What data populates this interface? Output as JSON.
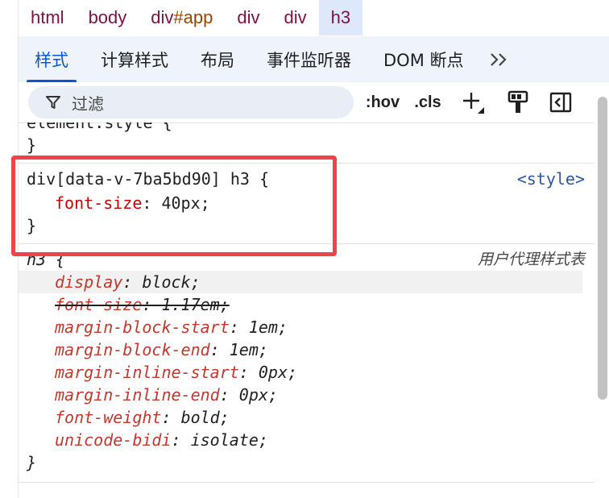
{
  "breadcrumb": {
    "items": [
      {
        "label": "html"
      },
      {
        "label": "body"
      },
      {
        "label_prefix": "div",
        "label_suffix": "#app"
      },
      {
        "label": "div"
      },
      {
        "label": "div"
      },
      {
        "label": "h3"
      }
    ],
    "active_index": 5
  },
  "tabs": {
    "items": [
      "样式",
      "计算样式",
      "布局",
      "事件监听器",
      "DOM 断点"
    ],
    "more_label": "»",
    "active_index": 0
  },
  "toolbar": {
    "filter_placeholder": "过滤",
    "hov_label": ":hov",
    "cls_label": ".cls",
    "icons": [
      "filter-icon",
      "add-rule-icon",
      "paint-roller-icon",
      "toggle-sidebar-icon"
    ]
  },
  "rules": {
    "element_style": {
      "selector_partial": "element.style {",
      "close": "}"
    },
    "scoped_rule": {
      "selector": "div[data-v-7ba5bd90] h3 {",
      "source": "<style>",
      "prop": "font-size",
      "value": "40px;",
      "close": "}"
    },
    "ua_rule": {
      "selector": "h3 {",
      "origin_label": "用户代理样式表",
      "declarations": [
        {
          "prop": "display",
          "value": "block;",
          "overridden": false
        },
        {
          "prop": "font-size",
          "value": "1.17em;",
          "overridden": true
        },
        {
          "prop": "margin-block-start",
          "value": "1em;",
          "overridden": false
        },
        {
          "prop": "margin-block-end",
          "value": "1em;",
          "overridden": false
        },
        {
          "prop": "margin-inline-start",
          "value": "0px;",
          "overridden": false
        },
        {
          "prop": "margin-inline-end",
          "value": "0px;",
          "overridden": false
        },
        {
          "prop": "font-weight",
          "value": "bold;",
          "overridden": false
        },
        {
          "prop": "unicode-bidi",
          "value": "isolate;",
          "overridden": false
        }
      ],
      "close": "}"
    }
  },
  "colors": {
    "accent": "#0b57d0",
    "tab_bar_bg": "#eef3fc",
    "highlight_box": "#ef4444",
    "property": "#c80000"
  }
}
